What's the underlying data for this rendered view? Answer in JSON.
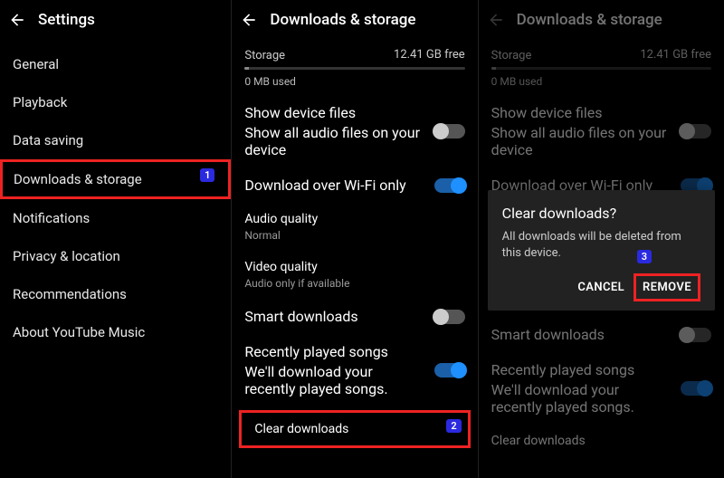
{
  "pane1": {
    "title": "Settings",
    "items": [
      "General",
      "Playback",
      "Data saving",
      "Downloads & storage",
      "Notifications",
      "Privacy & location",
      "Recommendations",
      "About YouTube Music"
    ],
    "highlight_index": 3,
    "badge": "1"
  },
  "pane2": {
    "title": "Downloads & storage",
    "storage_label": "Storage",
    "storage_free": "12.41 GB free",
    "storage_used": "0 MB used",
    "show_device": {
      "title": "Show device files",
      "sub": "Show all audio files on your device",
      "on": false
    },
    "wifi_only": {
      "title": "Download over Wi-Fi only",
      "on": true
    },
    "audio_q": {
      "title": "Audio quality",
      "sub": "Normal"
    },
    "video_q": {
      "title": "Video quality",
      "sub": "Audio only if available"
    },
    "smart_dl": {
      "title": "Smart downloads",
      "on": false
    },
    "recent": {
      "title": "Recently played songs",
      "sub": "We'll download your recently played songs.",
      "on": true
    },
    "clear": "Clear downloads",
    "badge": "2"
  },
  "pane3": {
    "title": "Downloads & storage",
    "storage_label": "Storage",
    "storage_free": "12.41 GB free",
    "storage_used": "0 MB used",
    "show_device": {
      "title": "Show device files",
      "sub": "Show all audio files on your device"
    },
    "wifi_only": {
      "title": "Download over Wi-Fi only"
    },
    "smart_dl": {
      "title": "Smart downloads"
    },
    "recent": {
      "title": "Recently played songs",
      "sub": "We'll download your recently played songs."
    },
    "clear": "Clear downloads",
    "modal": {
      "title": "Clear downloads?",
      "message": "All downloads will be deleted from this device.",
      "cancel": "CANCEL",
      "remove": "REMOVE",
      "badge": "3"
    }
  }
}
